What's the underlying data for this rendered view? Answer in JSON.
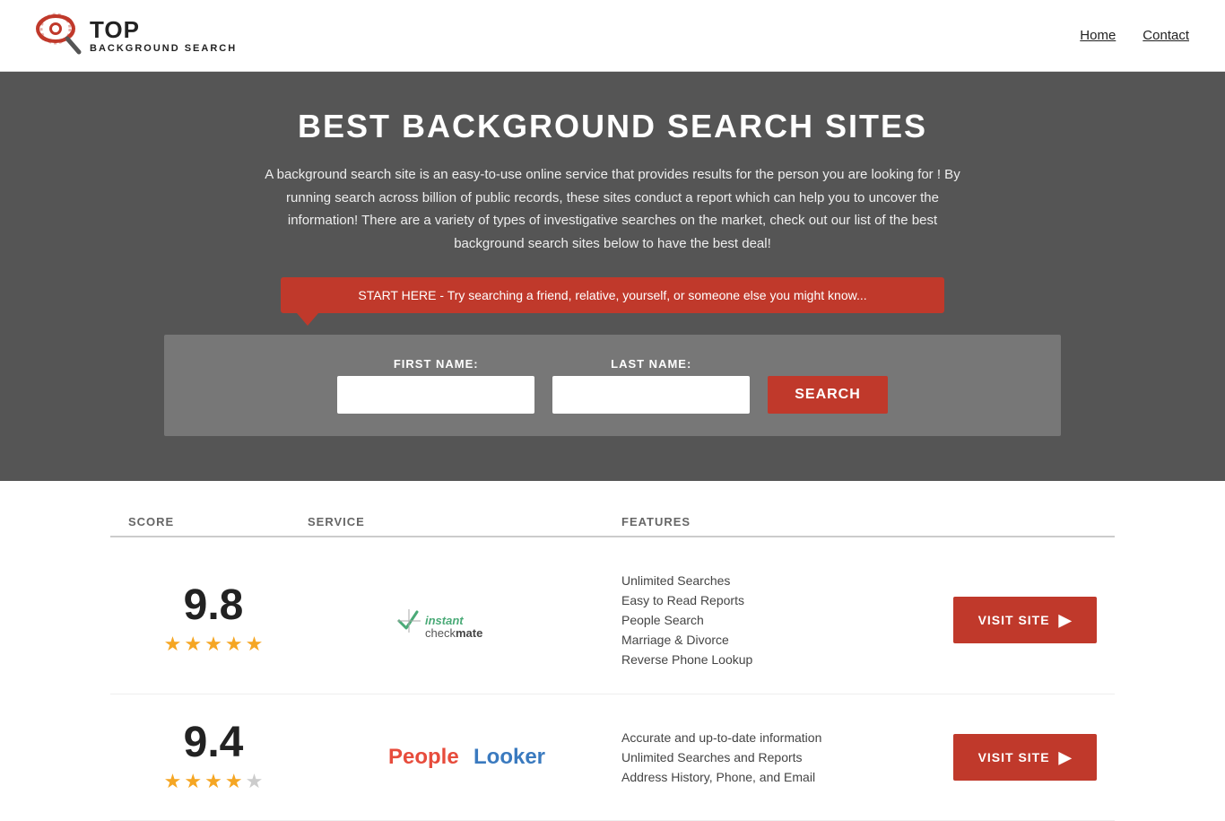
{
  "header": {
    "logo_top": "TOP",
    "logo_bottom": "BACKGROUND SEARCH",
    "nav": [
      {
        "label": "Home",
        "href": "#"
      },
      {
        "label": "Contact",
        "href": "#"
      }
    ]
  },
  "hero": {
    "title": "BEST BACKGROUND SEARCH SITES",
    "description": "A background search site is an easy-to-use online service that provides results  for the person you are looking for ! By  running  search across billion of public records, these sites conduct  a report which can help you to uncover the information! There are a variety of types of investigative searches on the market, check out our  list of the best background search sites below to have the best deal!",
    "callout": "START HERE - Try searching a friend, relative, yourself, or someone else you might know..."
  },
  "search_form": {
    "first_name_label": "FIRST NAME:",
    "last_name_label": "LAST NAME:",
    "search_button": "SEARCH"
  },
  "table": {
    "headers": {
      "score": "SCORE",
      "service": "SERVICE",
      "features": "FEATURES",
      "action": ""
    },
    "rows": [
      {
        "score": "9.8",
        "stars": 4.5,
        "service_name": "Instant Checkmate",
        "features": [
          "Unlimited Searches",
          "Easy to Read Reports",
          "People Search",
          "Marriage & Divorce",
          "Reverse Phone Lookup"
        ],
        "visit_label": "VISIT SITE"
      },
      {
        "score": "9.4",
        "stars": 4,
        "service_name": "PeopleLooker",
        "features": [
          "Accurate and up-to-date information",
          "Unlimited Searches and Reports",
          "Address History, Phone, and Email"
        ],
        "visit_label": "VISIT SITE"
      }
    ]
  }
}
